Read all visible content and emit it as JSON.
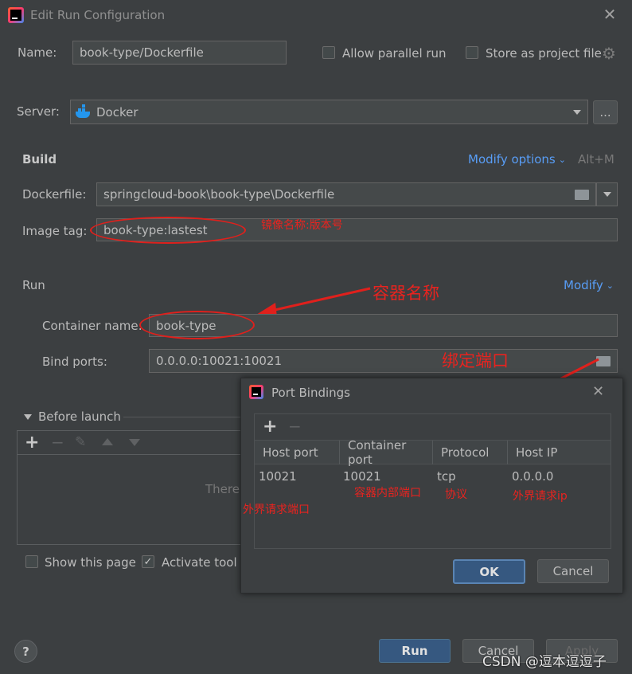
{
  "window": {
    "title": "Edit Run Configuration"
  },
  "top": {
    "name_label": "Name:",
    "name_value": "book-type/Dockerfile",
    "allow_parallel": "Allow parallel run",
    "store_project": "Store as project file"
  },
  "server": {
    "label": "Server:",
    "value": "Docker",
    "more_button": "..."
  },
  "build": {
    "section": "Build",
    "modify_options": "Modify options",
    "shortcut": "Alt+M",
    "dockerfile_label": "Dockerfile:",
    "dockerfile_value": "springcloud-book\\book-type\\Dockerfile",
    "image_tag_label": "Image tag:",
    "image_tag_value": "book-type:lastest"
  },
  "run": {
    "section": "Run",
    "modify": "Modify",
    "container_label": "Container name:",
    "container_value": "book-type",
    "bind_ports_label": "Bind ports:",
    "bind_ports_value": "0.0.0.0:10021:10021"
  },
  "before_launch": {
    "title": "Before launch",
    "empty_text": "There"
  },
  "bottom": {
    "show_page": "Show this page",
    "activate_tool": "Activate tool",
    "run_button": "Run",
    "cancel_button": "Cancel",
    "apply_button": "Apply",
    "help_button": "?"
  },
  "port_dialog": {
    "title": "Port Bindings",
    "columns": [
      "Host port",
      "Container port",
      "Protocol",
      "Host IP"
    ],
    "row": [
      "10021",
      "10021",
      "tcp",
      "0.0.0.0"
    ],
    "ok": "OK",
    "cancel": "Cancel"
  },
  "annotations": {
    "image_name": "镜像名称:版本号",
    "container_name": "容器名称",
    "bind_port": "绑定端口",
    "external_port": "外界请求端口",
    "internal_port": "容器内部端口",
    "protocol": "协议",
    "external_ip": "外界请求ip"
  },
  "watermark": "CSDN @逗本逗逗子",
  "colors": {
    "background": "#3c3f41",
    "field": "#45494a",
    "link": "#589df6",
    "primary_button": "#365880",
    "annotation": "#e8231f"
  }
}
